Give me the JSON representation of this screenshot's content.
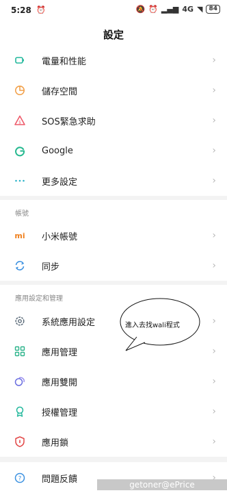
{
  "status_bar": {
    "time": "5:28",
    "network": "4G",
    "battery": "84"
  },
  "header": {
    "title": "設定"
  },
  "group1": [
    {
      "label": "電量和性能",
      "icon": "battery-icon",
      "color": "#22b89c"
    },
    {
      "label": "儲存空間",
      "icon": "storage-pie-icon",
      "color": "#f2a14b"
    },
    {
      "label": "SOS緊急求助",
      "icon": "sos-warning-icon",
      "color": "#ee5a6a"
    },
    {
      "label": "Google",
      "icon": "google-icon",
      "color": "#25b88f"
    },
    {
      "label": "更多設定",
      "icon": "more-dots-icon",
      "color": "#2bb2c8"
    }
  ],
  "accounts": {
    "header": "帳號",
    "items": [
      {
        "label": "小米帳號",
        "icon": "mi-logo-icon",
        "color": "#f0801e"
      },
      {
        "label": "同步",
        "icon": "sync-icon",
        "color": "#3a90e0"
      }
    ]
  },
  "apps": {
    "header": "應用設定和管理",
    "items": [
      {
        "label": "系統應用設定",
        "icon": "gear-icon",
        "color": "#5a6a78"
      },
      {
        "label": "應用管理",
        "icon": "grid-apps-icon",
        "color": "#2bb38a"
      },
      {
        "label": "應用雙開",
        "icon": "dual-apps-icon",
        "color": "#6a6ee0"
      },
      {
        "label": "授權管理",
        "icon": "badge-icon",
        "color": "#22b89c"
      },
      {
        "label": "應用鎖",
        "icon": "shield-lock-icon",
        "color": "#e24848"
      }
    ]
  },
  "feedback": {
    "label": "問題反饋",
    "icon": "question-icon",
    "color": "#3a90e0"
  },
  "annotation": {
    "text": "進入去找wali程式"
  },
  "watermark": "getoner@ePrice"
}
